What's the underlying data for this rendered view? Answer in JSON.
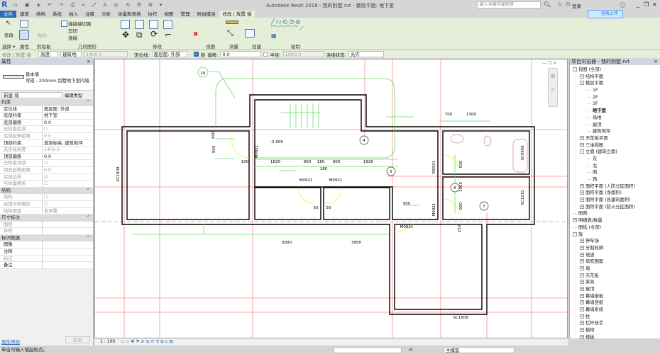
{
  "titlebar": {
    "title": "Autodesk Revit 2018 -    我的别墅.rvt - 楼层平面: 地下室",
    "search_placeholder": "键入关键字或短语",
    "login": "登录",
    "upload": "拖拽上传"
  },
  "tabs": [
    "文件",
    "建筑",
    "结构",
    "系统",
    "插入",
    "注释",
    "分析",
    "体量和场地",
    "协作",
    "视图",
    "管理",
    "附加模块",
    "修改 | 放置 墙"
  ],
  "ribbon": {
    "modify": "修改",
    "paste": "粘贴",
    "join_cut": "连接端切割",
    "cut": "剪切",
    "join": "连接",
    "panels": [
      "选择 ▾",
      "属性",
      "剪贴板",
      "几何图形",
      "修改",
      "视图",
      "测量",
      "创建",
      "绘制"
    ]
  },
  "options": {
    "context": "修改 | 放置 墙",
    "height_label": "高度:",
    "height_target": "建筑地:",
    "height_value": "1400.0",
    "locline_label": "定位线:",
    "locline_value": "面层面: 外部",
    "chain_label": "链",
    "chain_checked": true,
    "offset_label": "偏移:",
    "offset_value": "0.0",
    "radius_label": "半径:",
    "radius_value": "1000.0",
    "join_label": "连接状态:",
    "join_value": "允许"
  },
  "properties": {
    "title": "属性",
    "family": "基本墙",
    "type": "常规 - 200mm-别墅地下室内墙",
    "selector": "新建 墙",
    "edit_type": "编辑类型",
    "groups": [
      {
        "name": "约束",
        "rows": [
          [
            "定位线",
            "面层面: 外部",
            ""
          ],
          [
            "底部约束",
            "地下室",
            ""
          ],
          [
            "底部偏移",
            "0.0",
            ""
          ],
          [
            "已附着底部",
            "☐",
            "dim"
          ],
          [
            "底部延伸距离",
            "0.0",
            "dim"
          ],
          [
            "顶部约束",
            "直到标高: 建筑地坪",
            ""
          ],
          [
            "无连接高度",
            "1400.0",
            "dim"
          ],
          [
            "顶部偏移",
            "0.0",
            ""
          ],
          [
            "已附着顶部",
            "☐",
            "dim"
          ],
          [
            "顶部延伸距离",
            "0.0",
            "dim"
          ],
          [
            "房间边界",
            "☑",
            "dim"
          ],
          [
            "与体量相关",
            "☐",
            "dim"
          ]
        ]
      },
      {
        "name": "结构",
        "rows": [
          [
            "结构",
            "☐",
            "dim"
          ],
          [
            "启用分析模型",
            "☐",
            "dim"
          ],
          [
            "结构用途",
            "非承重",
            "dim"
          ]
        ]
      },
      {
        "name": "尺寸标注",
        "rows": [
          [
            "面积",
            "",
            "dim"
          ],
          [
            "体积",
            "",
            "dim"
          ]
        ]
      },
      {
        "name": "标识数据",
        "rows": [
          [
            "图像",
            "",
            ""
          ],
          [
            "注释",
            "",
            ""
          ],
          [
            "标记",
            "",
            "dim"
          ],
          [
            "备注",
            "",
            ""
          ]
        ]
      }
    ],
    "help": "属性帮助",
    "apply": "应用"
  },
  "browser": {
    "title": "项目浏览器 - 我的别墅.rvt",
    "items": [
      [
        "视图 (全部)",
        0,
        "-"
      ],
      [
        "结构平面",
        1,
        "+"
      ],
      [
        "楼层平面",
        1,
        "-"
      ],
      [
        "1F",
        2,
        ""
      ],
      [
        "2F",
        2,
        ""
      ],
      [
        "3F",
        2,
        ""
      ],
      [
        "地下室",
        2,
        "sel"
      ],
      [
        "场地",
        2,
        ""
      ],
      [
        "屋顶",
        2,
        ""
      ],
      [
        "建筑地坪",
        2,
        ""
      ],
      [
        "天花板平面",
        1,
        "+"
      ],
      [
        "三维视图",
        1,
        "+"
      ],
      [
        "立面 (建筑立面)",
        1,
        "-"
      ],
      [
        "东",
        2,
        ""
      ],
      [
        "北",
        2,
        ""
      ],
      [
        "南",
        2,
        ""
      ],
      [
        "西",
        2,
        ""
      ],
      [
        "面积平面 (人防分区面积)",
        1,
        "+"
      ],
      [
        "面积平面 (净面积)",
        1,
        "+"
      ],
      [
        "面积平面 (总建筑面积)",
        1,
        "+"
      ],
      [
        "面积平面 (防火分区面积)",
        1,
        "+"
      ],
      [
        "图例",
        0,
        ""
      ],
      [
        "明细表/数量",
        0,
        "+"
      ],
      [
        "图纸 (全部)",
        0,
        ""
      ],
      [
        "族",
        0,
        "-"
      ],
      [
        "停车场",
        1,
        "+"
      ],
      [
        "分割轮廓",
        1,
        "+"
      ],
      [
        "坡道",
        1,
        "+"
      ],
      [
        "填充图案",
        1,
        "+"
      ],
      [
        "墙",
        1,
        "+"
      ],
      [
        "天花板",
        1,
        "+"
      ],
      [
        "家具",
        1,
        "+"
      ],
      [
        "屋顶",
        1,
        "+"
      ],
      [
        "幕墙嵌板",
        1,
        "+"
      ],
      [
        "幕墙竖梃",
        1,
        "+"
      ],
      [
        "幕墙系统",
        1,
        "+"
      ],
      [
        "柱",
        1,
        "+"
      ],
      [
        "栏杆扶手",
        1,
        "+"
      ],
      [
        "植物",
        1,
        "+"
      ],
      [
        "楼板",
        1,
        "+"
      ]
    ]
  },
  "plan": {
    "labels": [
      "10",
      "-2.900",
      "400",
      "900",
      "100",
      "1820",
      "900",
      "180",
      "900",
      "1920",
      "180",
      "M0921",
      "M0921",
      "M0921",
      "SC1808",
      "50",
      "50",
      "900",
      "M0921",
      "M0921",
      "700",
      "1300",
      "SC0908",
      "820",
      "1000",
      "800",
      "SC1210",
      "M0921",
      "3000",
      "3000",
      "SC1508",
      "4",
      "5",
      "6",
      "7",
      "250"
    ]
  },
  "viewbar": {
    "scale": "1 : 100"
  },
  "statusbar": {
    "hint": "单击可输入墙起始点。",
    "count": ":0",
    "model": "主模型"
  },
  "colors": {
    "ribbon": "#e4eed8",
    "grid": "#ff8080",
    "dimension": "#66dd66",
    "wall": "#000000",
    "door": "#ffff66"
  }
}
